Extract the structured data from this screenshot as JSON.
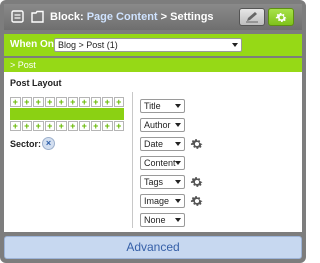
{
  "header": {
    "block_label": "Block:",
    "block_link": "Page Content",
    "separator": ">",
    "settings_label": "Settings"
  },
  "when_on": {
    "label": "When On:",
    "selected": "Blog > Post (1)"
  },
  "post_bar": {
    "label": "> Post"
  },
  "layout": {
    "title": "Post Layout",
    "sector_label": "Sector:",
    "sector_remove": "×",
    "grid_plus": "+"
  },
  "options": [
    {
      "value": "Title",
      "gear": false
    },
    {
      "value": "Author",
      "gear": false
    },
    {
      "value": "Date",
      "gear": true
    },
    {
      "value": "Content",
      "gear": false
    },
    {
      "value": "Tags",
      "gear": true
    },
    {
      "value": "Image",
      "gear": true
    },
    {
      "value": "None",
      "gear": false
    }
  ],
  "footer": {
    "label": "Advanced"
  },
  "colors": {
    "accent_green": "#96d916",
    "footer_blue": "#c7d8f0",
    "footer_text": "#3660a8"
  },
  "icons": {
    "header_left_1": "notes-icon",
    "header_left_2": "block-icon",
    "edit": "pencil-icon",
    "settings": "gear-icon"
  }
}
